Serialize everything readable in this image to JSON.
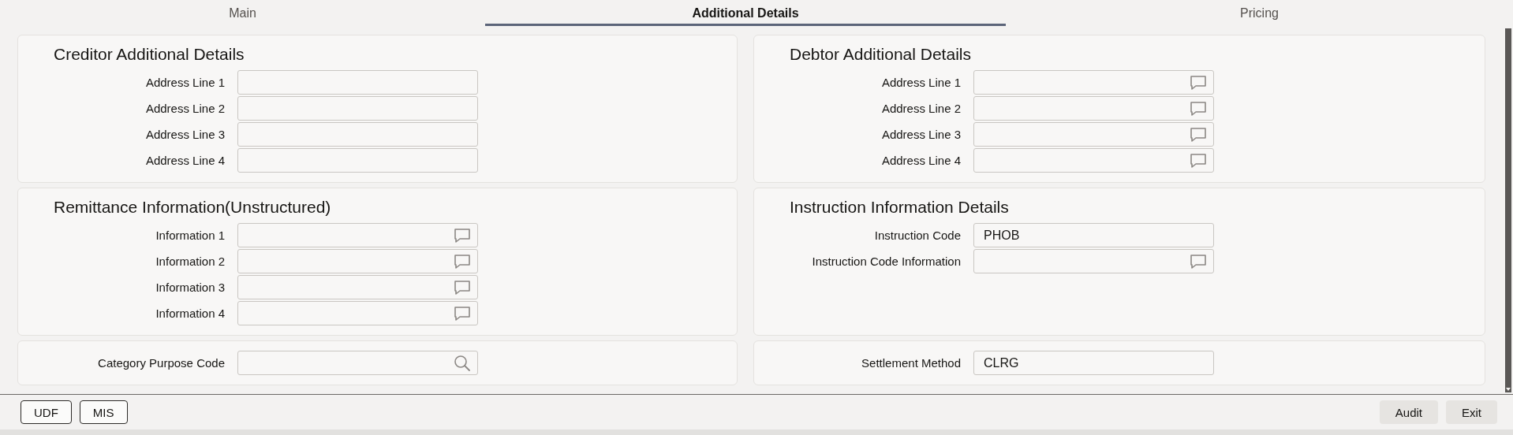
{
  "tabs": [
    {
      "label": "Main",
      "selected": false
    },
    {
      "label": "Additional Details",
      "selected": true
    },
    {
      "label": "Pricing",
      "selected": false
    }
  ],
  "panels": [
    {
      "title": "Creditor Additional Details",
      "fields": [
        {
          "label": "Address Line 1",
          "kind": "plain"
        },
        {
          "label": "Address Line 2",
          "kind": "plain"
        },
        {
          "label": "Address Line 3",
          "kind": "plain"
        },
        {
          "label": "Address Line 4",
          "kind": "plain"
        }
      ]
    },
    {
      "title": "Debtor Additional Details",
      "fields": [
        {
          "label": "Address Line 1",
          "kind": "comment"
        },
        {
          "label": "Address Line 2",
          "kind": "comment"
        },
        {
          "label": "Address Line 3",
          "kind": "comment"
        },
        {
          "label": "Address Line 4",
          "kind": "comment"
        }
      ]
    },
    {
      "title": "Remittance Information(Unstructured)",
      "fields": [
        {
          "label": "Information 1",
          "kind": "comment"
        },
        {
          "label": "Information 2",
          "kind": "comment"
        },
        {
          "label": "Information 3",
          "kind": "comment"
        },
        {
          "label": "Information 4",
          "kind": "comment"
        }
      ]
    },
    {
      "title": "Instruction Information Details",
      "fields": [
        {
          "label": "Instruction Code",
          "kind": "plain",
          "value": "PHOB"
        },
        {
          "label": "Instruction Code Information",
          "kind": "comment"
        }
      ]
    },
    {
      "fields": [
        {
          "label": "Category Purpose Code",
          "kind": "search"
        }
      ]
    },
    {
      "fields": [
        {
          "label": "Settlement Method",
          "kind": "plain",
          "value": "CLRG"
        }
      ]
    }
  ],
  "footer": {
    "left_buttons": [
      {
        "label": "UDF",
        "kind": "outline"
      },
      {
        "label": "MIS",
        "kind": "outline"
      }
    ],
    "right_buttons": [
      {
        "label": "Audit",
        "kind": "filled"
      },
      {
        "label": "Exit",
        "kind": "filled"
      }
    ]
  }
}
